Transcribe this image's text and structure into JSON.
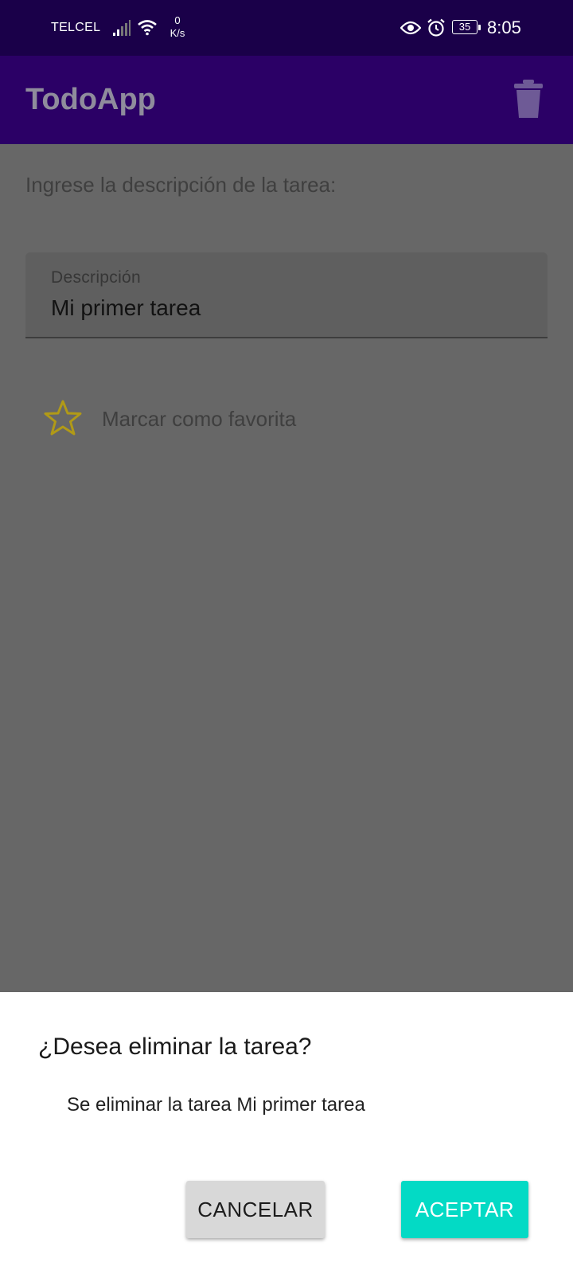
{
  "status_bar": {
    "carrier": "TELCEL",
    "net_speed_value": "0",
    "net_speed_unit": "K/s",
    "battery": "35",
    "time": "8:05",
    "icons": [
      "signal-icon",
      "wifi-icon",
      "eye-icon",
      "alarm-icon",
      "battery-icon"
    ]
  },
  "app_bar": {
    "title": "TodoApp",
    "action_icon": "trash-icon"
  },
  "form": {
    "prompt": "Ingrese la descripción de la tarea:",
    "description_label": "Descripción",
    "description_value": "Mi primer tarea",
    "favorite_label": "Marcar como favorita",
    "favorite_icon": "star-outline-icon"
  },
  "dialog": {
    "title": "¿Desea eliminar la tarea?",
    "message": "Se eliminar la tarea Mi primer tarea",
    "cancel_label": "CANCELAR",
    "accept_label": "ACEPTAR"
  },
  "colors": {
    "status_bar": "#1a0049",
    "app_bar": "#2b0066",
    "scrim": "#676767",
    "accent": "#03dac5",
    "star": "#b19a17"
  }
}
